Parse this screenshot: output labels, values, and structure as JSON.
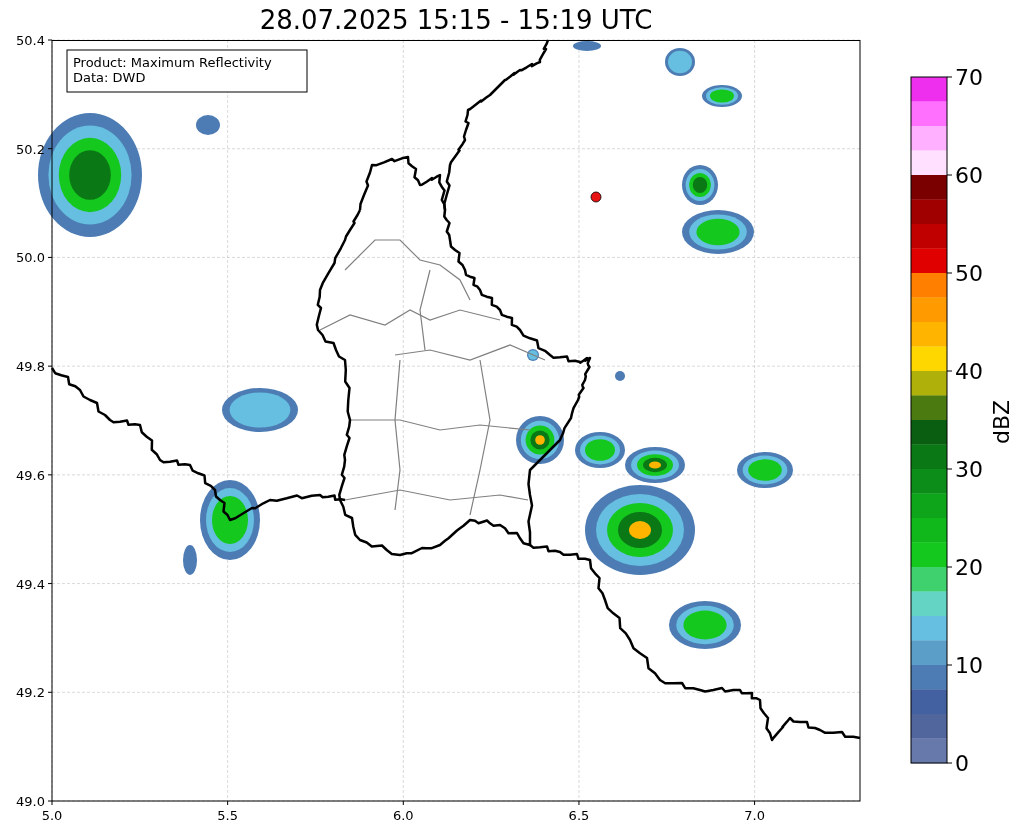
{
  "map": {
    "title": "28.07.2025 15:15 - 15:19 UTC",
    "x_ticks": [
      "5.0",
      "5.5",
      "6.0",
      "6.5",
      "7.0"
    ],
    "y_ticks": [
      "50.4",
      "50.2",
      "50.0",
      "49.8",
      "49.6",
      "49.4",
      "49.2",
      "49.0"
    ],
    "info_lines": [
      "Product: Maximum Reflectivity",
      "Data: DWD"
    ]
  },
  "colorbar": {
    "label": "dBZ",
    "ticks": [
      "70",
      "60",
      "50",
      "40",
      "30",
      "20",
      "10",
      "0"
    ],
    "bands": [
      {
        "color": "#ee30ee"
      },
      {
        "color": "#ff70ff"
      },
      {
        "color": "#ffb0ff"
      },
      {
        "color": "#ffe0ff"
      },
      {
        "color": "#7a0000"
      },
      {
        "color": "#a00000"
      },
      {
        "color": "#c00000"
      },
      {
        "color": "#e00000"
      },
      {
        "color": "#ff7f00"
      },
      {
        "color": "#ff9a00"
      },
      {
        "color": "#ffb400"
      },
      {
        "color": "#ffd700"
      },
      {
        "color": "#b0b00a"
      },
      {
        "color": "#4a7a10"
      },
      {
        "color": "#0a5e12"
      },
      {
        "color": "#0a7814"
      },
      {
        "color": "#0c8c18"
      },
      {
        "color": "#0ea51a"
      },
      {
        "color": "#10b81c"
      },
      {
        "color": "#14c81e"
      },
      {
        "color": "#3ed16e"
      },
      {
        "color": "#64d4c4"
      },
      {
        "color": "#66bee0"
      },
      {
        "color": "#5b9ec8"
      },
      {
        "color": "#4c7cb3"
      },
      {
        "color": "#4360a0"
      },
      {
        "color": "#52669e"
      },
      {
        "color": "#6679aa"
      }
    ]
  }
}
